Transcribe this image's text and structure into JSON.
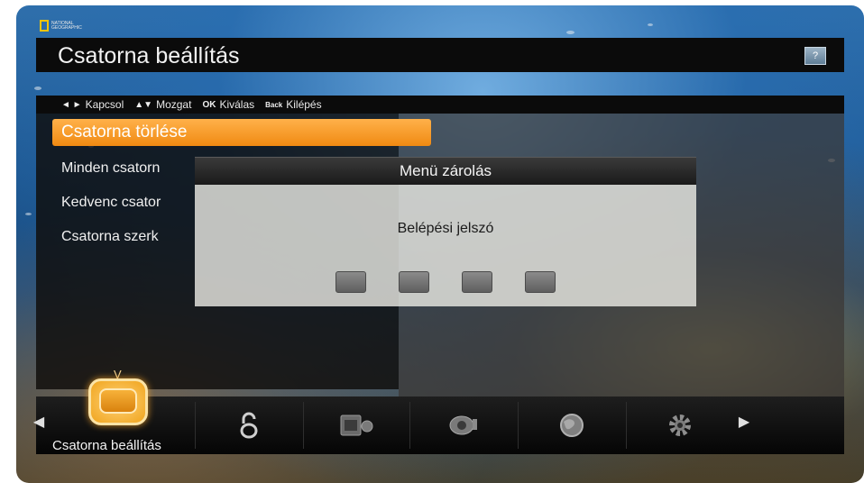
{
  "logo": {
    "text": "NATIONAL GEOGRAPHIC"
  },
  "header": {
    "title": "Csatorna beállítás",
    "help_label": "?"
  },
  "hints": [
    {
      "key": "◄ ►",
      "label": "Kapcsol"
    },
    {
      "key": "▲▼",
      "label": "Mozgat"
    },
    {
      "key": "OK",
      "label": "Kiválas"
    },
    {
      "key": "Back",
      "label": "Kilépés"
    }
  ],
  "menu": {
    "items": [
      {
        "label": "Csatorna törlése",
        "selected": true
      },
      {
        "label": "Minden csatorn",
        "selected": false
      },
      {
        "label": "Kedvenc csator",
        "selected": false
      },
      {
        "label": "Csatorna szerk",
        "selected": false
      }
    ]
  },
  "dialog": {
    "title": "Menü zárolás",
    "prompt": "Belépési jelszó",
    "pin_length": 4
  },
  "bottom_bar": {
    "caption": "Csatorna beállítás",
    "icons": [
      "tv-icon",
      "lock-icon",
      "media-icon",
      "camera-icon",
      "globe-icon",
      "gear-icon"
    ],
    "accent": "#f39a1c"
  }
}
